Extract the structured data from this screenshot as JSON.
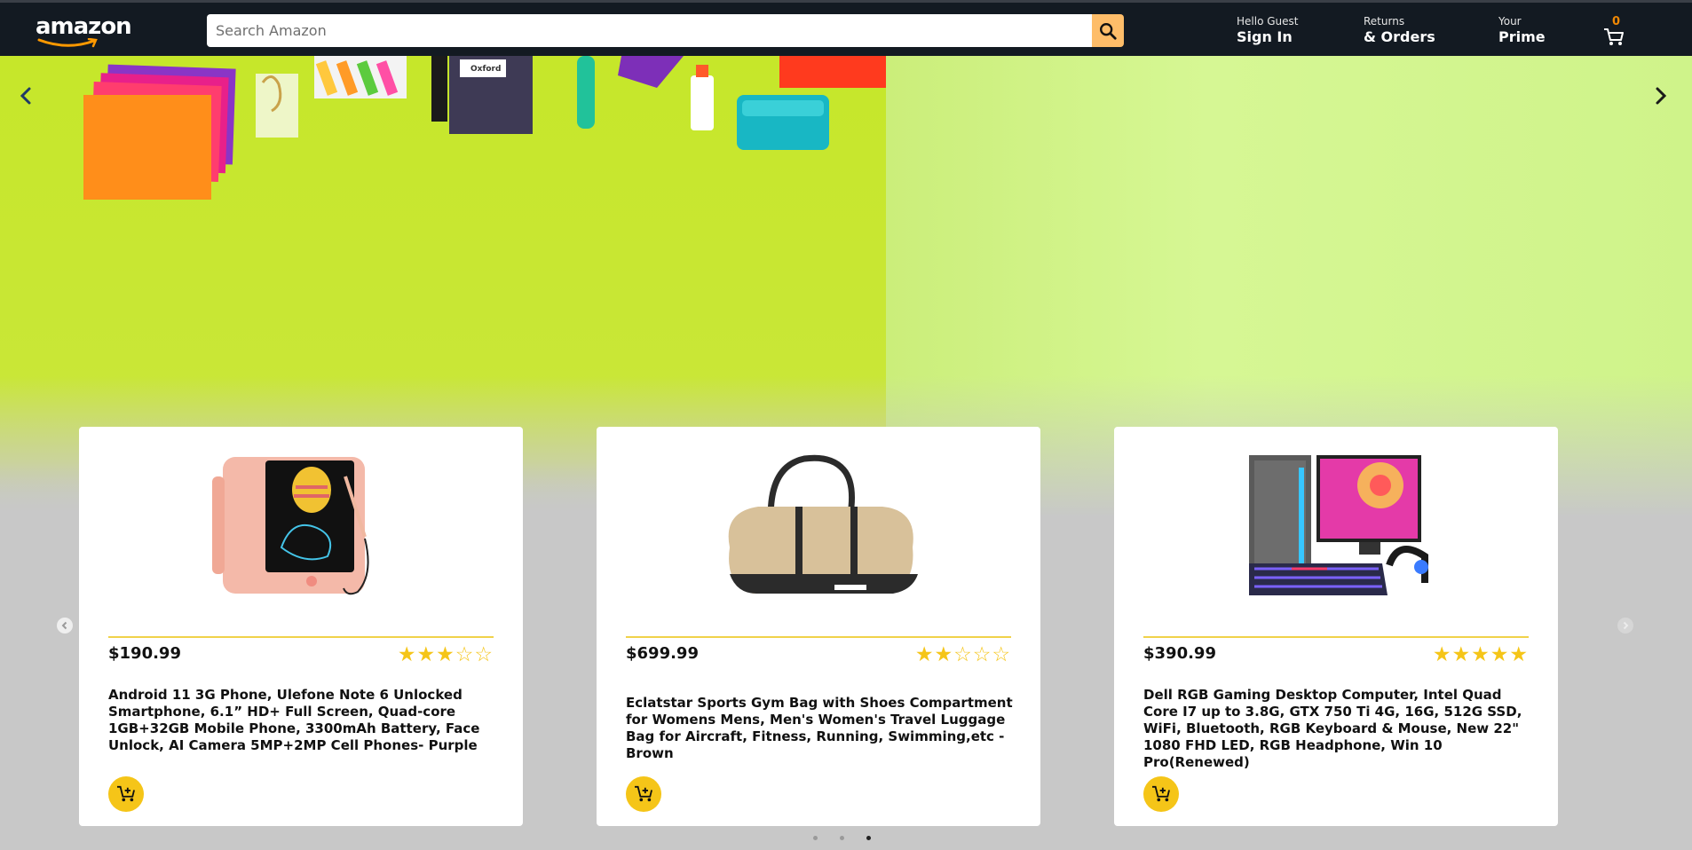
{
  "brand": {
    "logo_text": "amazon"
  },
  "search": {
    "placeholder": "Search Amazon",
    "icon": "search-icon"
  },
  "nav": {
    "account": {
      "line1": "Hello Guest",
      "line2": "Sign In"
    },
    "orders": {
      "line1": "Returns",
      "line2": "& Orders"
    },
    "prime": {
      "line1": "Your",
      "line2": "Prime"
    },
    "cart": {
      "count": "0",
      "icon": "cart-icon"
    }
  },
  "colors": {
    "nav_bg": "#131a22",
    "search_button": "#febd69",
    "accent_yellow": "#f5c518",
    "cart_count": "#f08804"
  },
  "products": [
    {
      "price": "$190.99",
      "rating": 3,
      "rating_max": 5,
      "stars": "★★★☆☆",
      "title": "Android 11 3G Phone, Ulefone Note 6 Unlocked Smartphone, 6.1” HD+ Full Screen, Quad-core 1GB+32GB Mobile Phone, 3300mAh Battery, Face Unlock, AI Camera 5MP+2MP Cell Phones- Purple"
    },
    {
      "price": "$699.99",
      "rating": 2,
      "rating_max": 5,
      "stars": "★★☆☆☆",
      "title": "Eclatstar Sports Gym Bag with Shoes Compartment for Womens Mens, Men's Women's Travel Luggage Bag for Aircraft, Fitness, Running, Swimming,etc -Brown"
    },
    {
      "price": "$390.99",
      "rating": 5,
      "rating_max": 5,
      "stars": "★★★★★",
      "title": "Dell RGB Gaming Desktop Computer, Intel Quad Core I7 up to 3.8G, GTX 750 Ti 4G, 16G, 512G SSD, WiFi, Bluetooth, RGB Keyboard & Mouse, New 22\" 1080 FHD LED, RGB Headphone, Win 10 Pro(Renewed)"
    }
  ],
  "carousel": {
    "slides": 3,
    "active_slide": 3
  }
}
